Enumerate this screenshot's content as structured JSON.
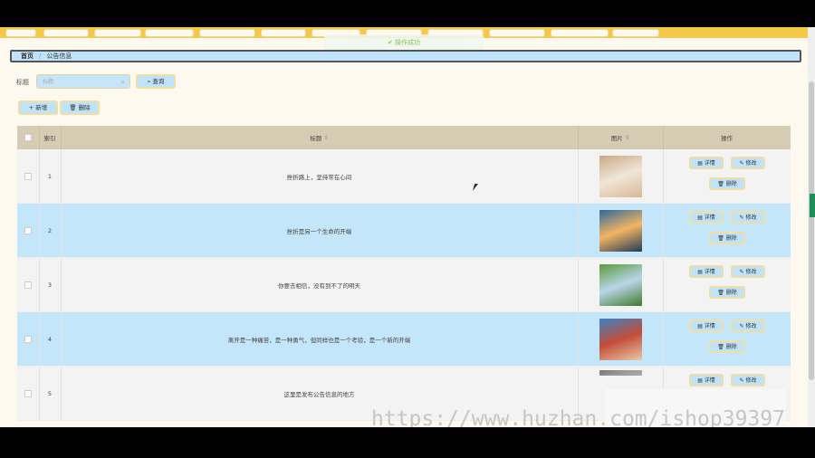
{
  "toast": "操作成功",
  "breadcrumb": {
    "home": "首页",
    "sep": "/",
    "current": "公告信息"
  },
  "filter": {
    "label": "标题",
    "placeholder": "标题",
    "search_button": "查询"
  },
  "toolbar": {
    "add": "新增",
    "delete": "删除"
  },
  "table": {
    "headers": {
      "index": "索引",
      "title": "标题",
      "image": "图片",
      "actions": "操作"
    },
    "rows": [
      {
        "index": "1",
        "title": "挫折路上，坚持常在心间",
        "colors": [
          "#caa885",
          "#efe6d8",
          "#d9b793"
        ]
      },
      {
        "index": "2",
        "title": "挫折是另一个生命的开端",
        "colors": [
          "#2c6a9c",
          "#f4b462",
          "#203a55"
        ]
      },
      {
        "index": "3",
        "title": "你要去相信，没有到不了的明天",
        "colors": [
          "#5a9a3c",
          "#b9d6e8",
          "#3f7a2b"
        ]
      },
      {
        "index": "4",
        "title": "离开是一种痛苦，是一种勇气，但同样也是一个考验，是一个新的开端",
        "colors": [
          "#3b82c4",
          "#c24d3a",
          "#e9c9a8"
        ]
      },
      {
        "index": "5",
        "title": "这里是发布公告信息的地方",
        "colors": [
          "#777777",
          "#999999",
          "#aaaaaa"
        ]
      }
    ],
    "actions": {
      "detail": "详情",
      "edit": "修改",
      "delete": "删除"
    }
  },
  "watermark": "https://www.huzhan.com/ishop39397",
  "colors": {
    "accent_yellow": "#f5c84a",
    "row_highlight": "#c4e6fa",
    "header_bg": "#d6ccb3"
  }
}
